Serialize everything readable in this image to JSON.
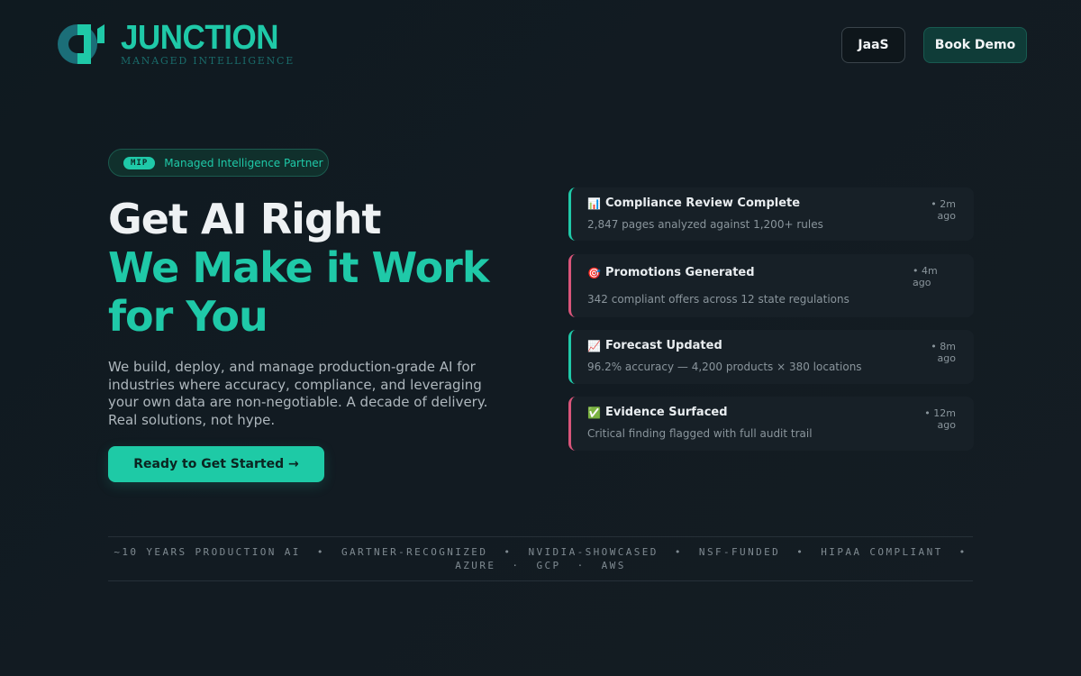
{
  "brand": {
    "name": "JUNCTION",
    "tagline": "MANAGED INTELLIGENCE",
    "logo_icon": "junction-logo-icon",
    "accent_color": "#1fc9a8"
  },
  "nav": {
    "jaas_label": "JaaS",
    "demo_label": "Book Demo"
  },
  "hero": {
    "badge_pill": "MIP",
    "badge_text": "Managed Intelligence Partner",
    "headline_line1": "Get AI Right",
    "headline_line2": "We Make it Work for You",
    "description": "We build, deploy, and manage production-grade AI for industries where accuracy, compliance, and leveraging your own data are non-negotiable.  A decade of delivery. Real solutions, not hype.",
    "cta_label": "Ready to Get Started →"
  },
  "activity": [
    {
      "icon": "bar-chart-icon",
      "emoji": "📊",
      "title": "Compliance Review Complete",
      "time": "• 2m ago",
      "desc": "2,847 pages analyzed against 1,200+ rules",
      "accent": "#1fc9a8"
    },
    {
      "icon": "target-icon",
      "emoji": "🎯",
      "title": "Promotions Generated",
      "time": "• 4m ago",
      "desc": "342 compliant offers across 12 state regulations",
      "accent": "#d9557a"
    },
    {
      "icon": "trending-up-icon",
      "emoji": "📈",
      "title": "Forecast Updated",
      "time": "• 8m ago",
      "desc": "96.2% accuracy — 4,200 products × 380 locations",
      "accent": "#1fc9a8"
    },
    {
      "icon": "check-mark-icon",
      "emoji": "✅",
      "title": "Evidence Surfaced",
      "time": "• 12m ago",
      "desc": "Critical finding flagged with full audit trail",
      "accent": "#d9557a"
    }
  ],
  "trust_bar": {
    "line1": "~10 YEARS PRODUCTION AI  •  GARTNER-RECOGNIZED  •  NVIDIA-SHOWCASED  •  NSF-FUNDED  •  HIPAA COMPLIANT  •",
    "line2": "AZURE  ·  GCP  ·  AWS"
  }
}
